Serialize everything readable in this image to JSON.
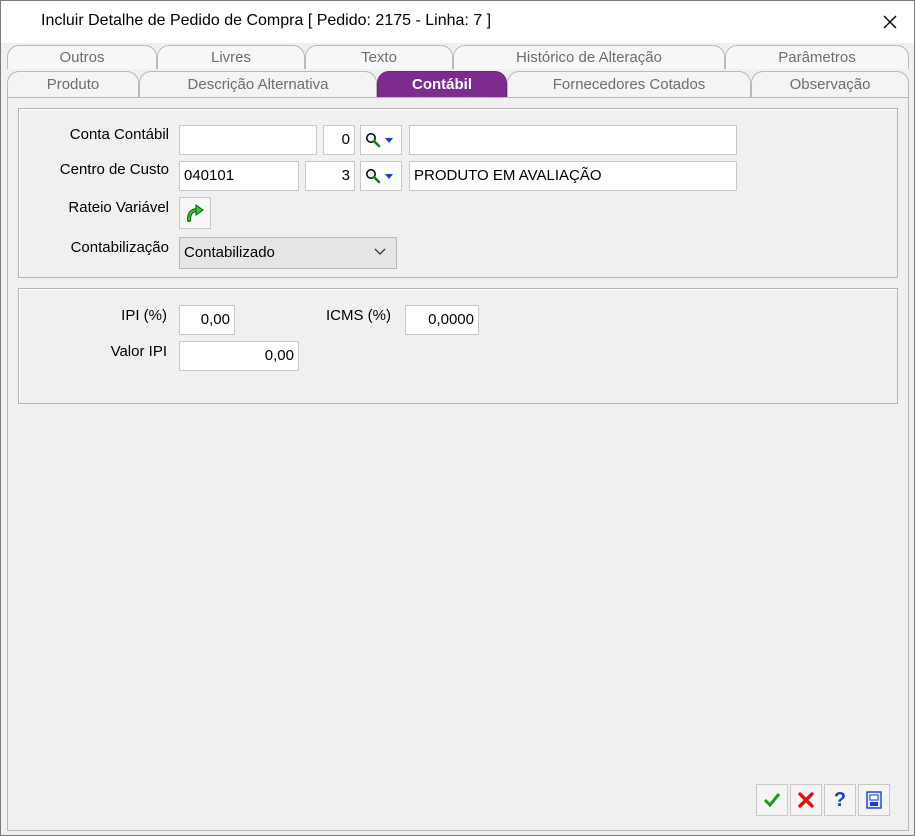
{
  "window": {
    "title": "Incluir Detalhe de Pedido de Compra [ Pedido: 2175  -  Linha: 7 ]"
  },
  "tabs": {
    "back_row": [
      "Outros",
      "Livres",
      "Texto",
      "Histórico de Alteração",
      "Parâmetros"
    ],
    "front_row": [
      "Produto",
      "Descrição Alternativa",
      "Contábil",
      "Fornecedores Cotados",
      "Observação"
    ],
    "active": "Contábil"
  },
  "contabil": {
    "conta_contabil": {
      "label": "Conta Contábil",
      "code": "",
      "digit": "0",
      "description": ""
    },
    "centro_de_custo": {
      "label": "Centro de Custo",
      "code": "040101",
      "digit": "3",
      "description": "PRODUTO EM AVALIAÇÃO"
    },
    "rateio_variavel": {
      "label": "Rateio Variável"
    },
    "contabilizacao": {
      "label": "Contabilização",
      "selected": "Contabilizado"
    }
  },
  "impostos": {
    "ipi_pct": {
      "label": "IPI (%)",
      "value": "0,00"
    },
    "icms_pct": {
      "label": "ICMS (%)",
      "value": "0,0000"
    },
    "valor_ipi": {
      "label": "Valor IPI",
      "value": "0,00"
    }
  },
  "icons": {
    "close": "close-icon",
    "lookup": "magnifier-icon",
    "rateio": "green-arrow-icon",
    "ok": "checkmark-icon",
    "cancel": "red-x-icon",
    "help": "question-icon",
    "print": "printer-icon"
  },
  "colors": {
    "active_tab": "#7d2b8f",
    "ok": "#1a9a1a",
    "cancel": "#e01010",
    "help": "#1a3fd0"
  }
}
